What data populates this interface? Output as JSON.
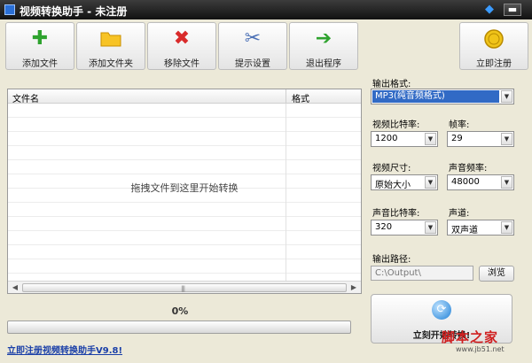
{
  "window": {
    "title": "视频转换助手 - 未注册",
    "minimize_glyph": "▬",
    "skin_icon": "diamond-icon"
  },
  "toolbar": {
    "add_file": "添加文件",
    "add_folder": "添加文件夹",
    "remove_file": "移除文件",
    "settings": "提示设置",
    "exit": "退出程序",
    "register": "立即注册"
  },
  "file_list": {
    "col_name": "文件名",
    "col_format": "格式",
    "drop_hint": "拖拽文件到这里开始转换",
    "scroll_grip": "|||"
  },
  "progress": {
    "percent_text": "0%",
    "value": 0
  },
  "register_link": "立即注册视频转换助手V9.8!",
  "settings": {
    "output_format_label": "输出格式:",
    "output_format_value": "MP3(纯音频格式)",
    "video_bitrate_label": "视频比特率:",
    "video_bitrate_value": "1200",
    "frame_rate_label": "帧率:",
    "frame_rate_value": "29",
    "video_size_label": "视频尺寸:",
    "video_size_value": "原始大小",
    "sample_rate_label": "声音频率:",
    "sample_rate_value": "48000",
    "audio_bitrate_label": "声音比特率:",
    "audio_bitrate_value": "320",
    "channels_label": "声道:",
    "channels_value": "双声道",
    "output_path_label": "输出路径:",
    "output_path_value": "C:\\Output\\",
    "browse_label": "浏览"
  },
  "start_button": {
    "label": "立刻开始转换!"
  },
  "watermark": {
    "main": "脚本之家",
    "sub": "www.jb51.net"
  },
  "colors": {
    "titlebar": "#1e1e1e",
    "selection": "#316ac5",
    "link": "#1a3fa8",
    "watermark": "#d02020"
  }
}
